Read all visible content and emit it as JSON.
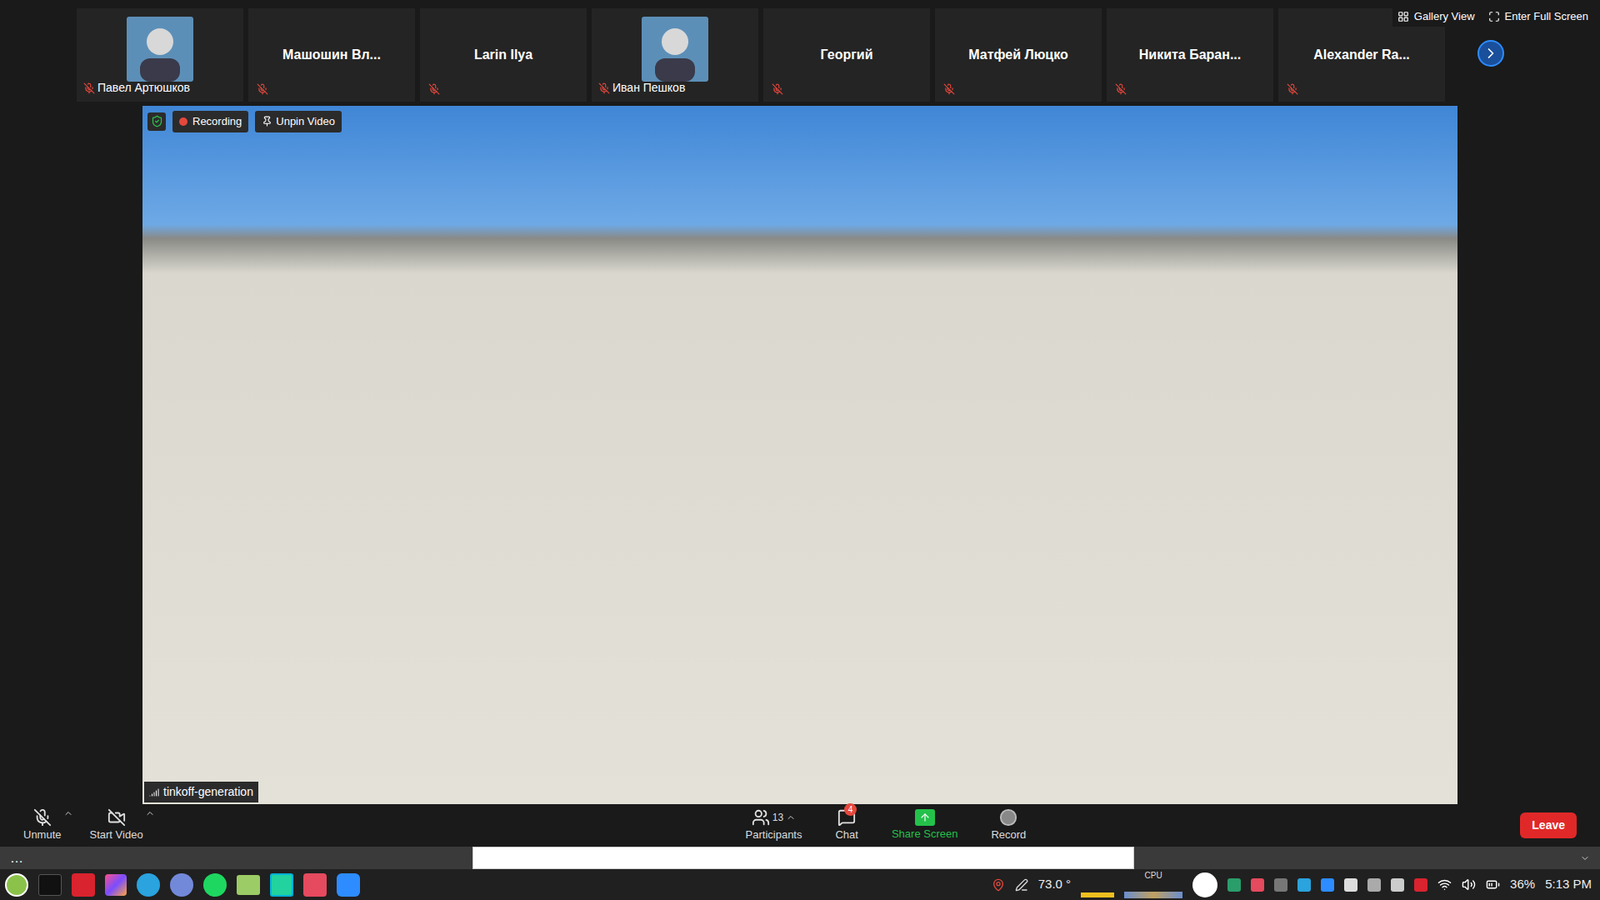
{
  "top_bar": {
    "gallery_view": "Gallery View",
    "full_screen": "Enter Full Screen"
  },
  "participants": [
    {
      "name": "Павел Артюшков",
      "muted": true,
      "avatar": true
    },
    {
      "name": "Машошин Вл...",
      "muted": true,
      "avatar": false
    },
    {
      "name": "Larin Ilya",
      "muted": true,
      "avatar": false
    },
    {
      "name": "Иван Пешков",
      "muted": true,
      "avatar": true
    },
    {
      "name": "Георгий",
      "muted": true,
      "avatar": false
    },
    {
      "name": "Матфей Люцко",
      "muted": true,
      "avatar": false
    },
    {
      "name": "Никита Баран...",
      "muted": true,
      "avatar": false
    },
    {
      "name": "Alexander Ra...",
      "muted": true,
      "avatar": false
    }
  ],
  "video": {
    "secure": true,
    "recording": "Recording",
    "unpin": "Unpin Video",
    "source": "tinkoff-generation"
  },
  "toolbar": {
    "left": [
      {
        "label": "Unmute",
        "kind": "mic"
      },
      {
        "label": "Start Video",
        "kind": "video"
      }
    ],
    "center": [
      {
        "label": "Participants",
        "kind": "participants",
        "count": "13",
        "badge": "",
        "highlight": false
      },
      {
        "label": "Chat",
        "kind": "chat",
        "count": "",
        "badge": "4",
        "highlight": false
      },
      {
        "label": "Share Screen",
        "kind": "share",
        "count": "",
        "badge": "",
        "highlight": true
      },
      {
        "label": "Record",
        "kind": "record",
        "count": "",
        "badge": "",
        "highlight": false
      }
    ],
    "leave": "Leave"
  },
  "taskbar": {
    "temperature": "73.0 °",
    "cpu": "CPU",
    "battery": "36%",
    "clock": "5:13 PM"
  }
}
